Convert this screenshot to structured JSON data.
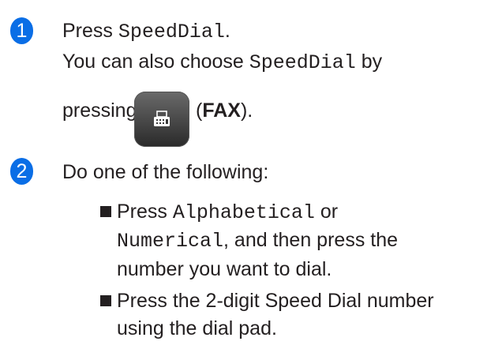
{
  "step1": {
    "badge": "1",
    "line1_press": "Press",
    "line1_key": "SpeedDial",
    "line1_end": ".",
    "line2_text": "You can also choose",
    "line2_key": "SpeedDial",
    "line2_by": "by",
    "line3_pressing": "pressing",
    "fax_open": "(",
    "fax_label": "FAX",
    "fax_close": ")."
  },
  "step2": {
    "badge": "2",
    "intro": "Do one of the following:",
    "bullet1": {
      "press": "Press",
      "key1": "Alphabetical",
      "or": "or",
      "key2": "Numerical",
      "rest1": ", and then press the",
      "rest2": "number you want to dial."
    },
    "bullet2": {
      "line1": "Press the 2-digit Speed Dial number",
      "line2": "using the dial pad."
    }
  },
  "icons": {
    "fax_button": "fax-icon",
    "bullet": "square-bullet-icon"
  },
  "colors": {
    "badge": "#0a6ee6",
    "text": "#231f20",
    "fax_button": "#3a3a3a"
  }
}
